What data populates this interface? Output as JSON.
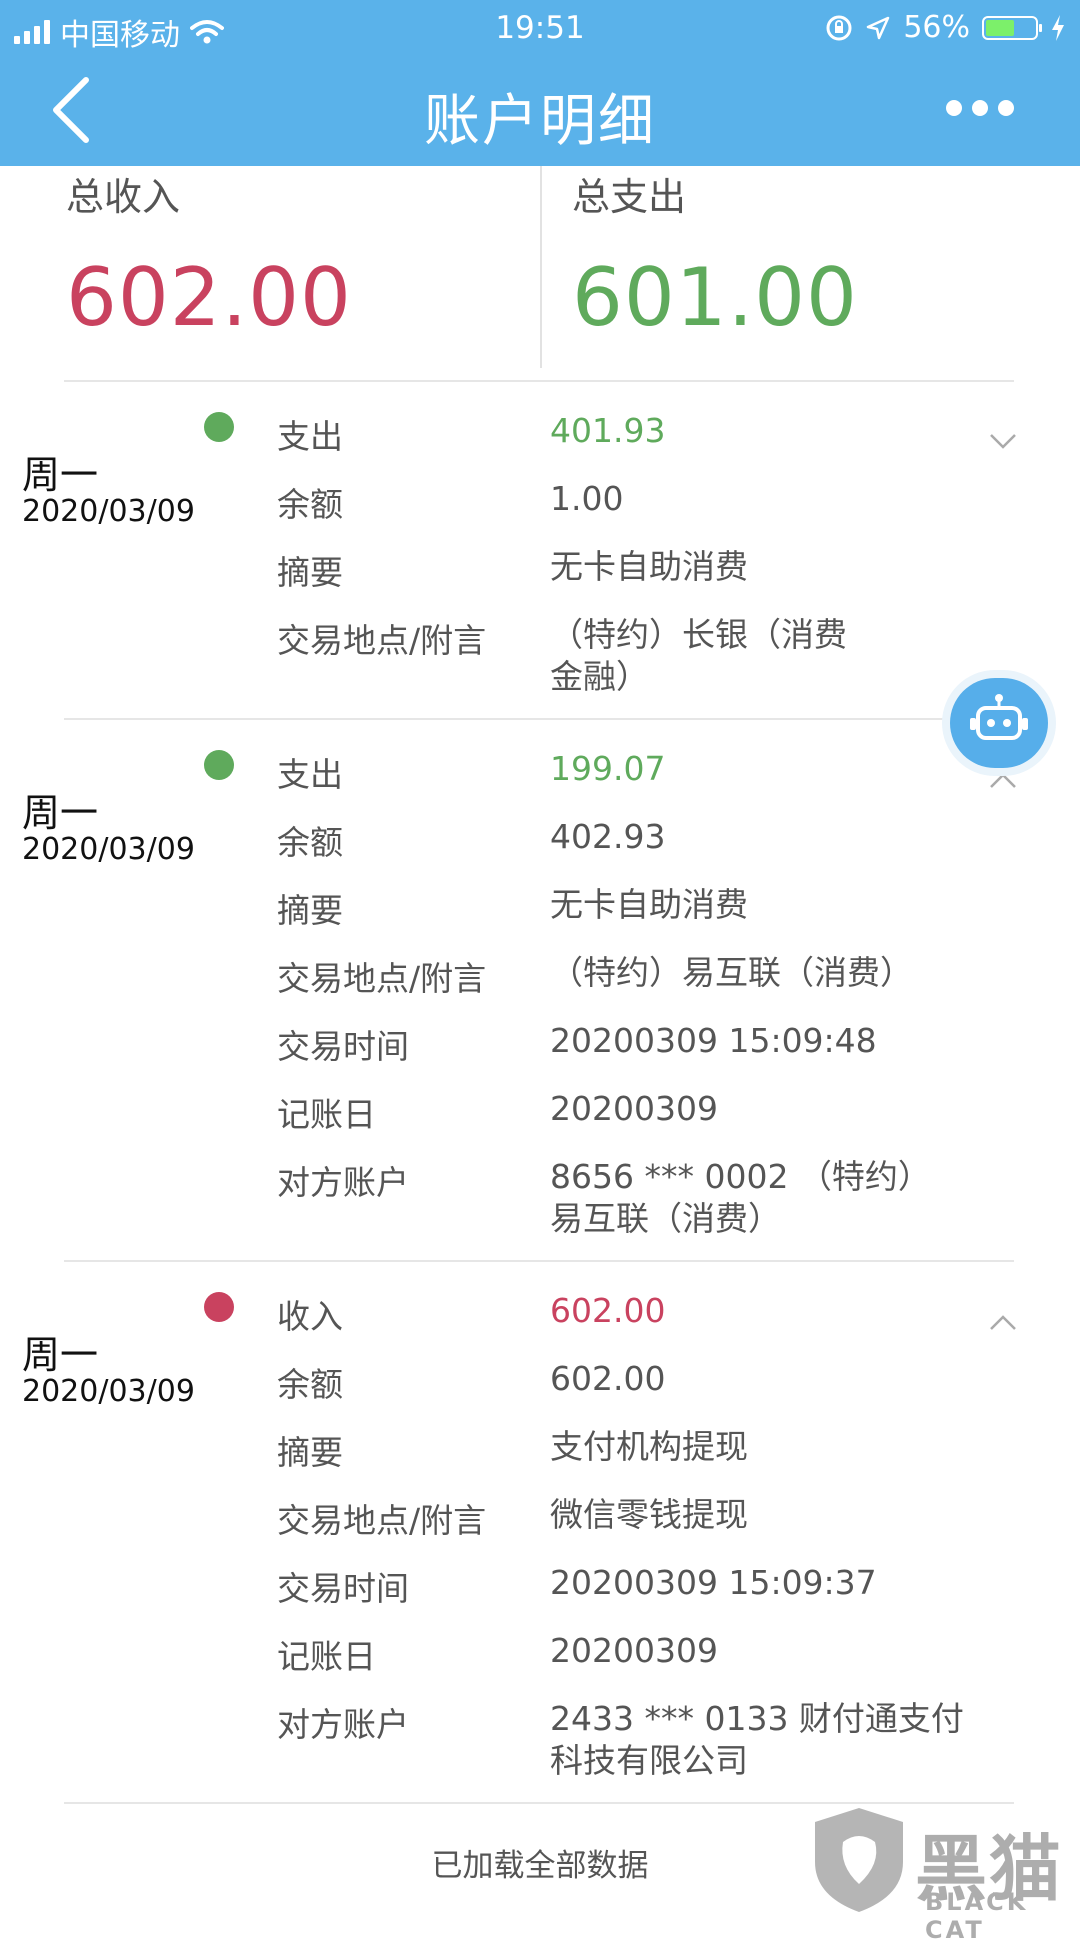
{
  "status_bar": {
    "carrier": "中国移动",
    "time": "19:51",
    "battery_percent": "56%",
    "icons": [
      "signal-icon",
      "wifi-icon",
      "rotation-lock-icon",
      "location-icon",
      "battery-icon",
      "charging-icon"
    ]
  },
  "nav": {
    "title": "账户明细",
    "back_icon": "chevron-left-icon",
    "more_icon": "more-dots-icon"
  },
  "summary": {
    "income_label": "总收入",
    "income_value": "602.00",
    "expense_label": "总支出",
    "expense_value": "601.00"
  },
  "colors": {
    "nav_bg": "#5ab2ea",
    "income": "#c9425f",
    "expense": "#5faa5c",
    "divider": "#e6e6e6"
  },
  "transactions": [
    {
      "day": "周一",
      "date": "2020/03/09",
      "type": "expense",
      "expanded": false,
      "fields": [
        {
          "label": "支出",
          "value": "401.93"
        },
        {
          "label": "余额",
          "value": "1.00"
        },
        {
          "label": "摘要",
          "value": "无卡自助消费"
        },
        {
          "label": "交易地点/附言",
          "value": "（特约）长银（消费",
          "value2": "金融）"
        }
      ]
    },
    {
      "day": "周一",
      "date": "2020/03/09",
      "type": "expense",
      "expanded": true,
      "fields": [
        {
          "label": "支出",
          "value": "199.07"
        },
        {
          "label": "余额",
          "value": "402.93"
        },
        {
          "label": "摘要",
          "value": "无卡自助消费"
        },
        {
          "label": "交易地点/附言",
          "value": "（特约）易互联（消费）"
        },
        {
          "label": "交易时间",
          "value": "20200309 15:09:48"
        },
        {
          "label": "记账日",
          "value": "20200309"
        },
        {
          "label": "对方账户",
          "value": "8656 *** 0002 （特约）",
          "value2": "易互联（消费）"
        }
      ]
    },
    {
      "day": "周一",
      "date": "2020/03/09",
      "type": "income",
      "expanded": true,
      "fields": [
        {
          "label": "收入",
          "value": "602.00"
        },
        {
          "label": "余额",
          "value": "602.00"
        },
        {
          "label": "摘要",
          "value": "支付机构提现"
        },
        {
          "label": "交易地点/附言",
          "value": "微信零钱提现"
        },
        {
          "label": "交易时间",
          "value": "20200309 15:09:37"
        },
        {
          "label": "记账日",
          "value": "20200309"
        },
        {
          "label": "对方账户",
          "value": "2433 *** 0133 财付通支付",
          "value2": "科技有限公司"
        }
      ]
    }
  ],
  "footer": {
    "loaded_text": "已加载全部数据"
  },
  "assistant": {
    "icon": "robot-icon"
  },
  "watermark": {
    "text_cn": "黑猫",
    "text_en": "BLACK CAT"
  }
}
